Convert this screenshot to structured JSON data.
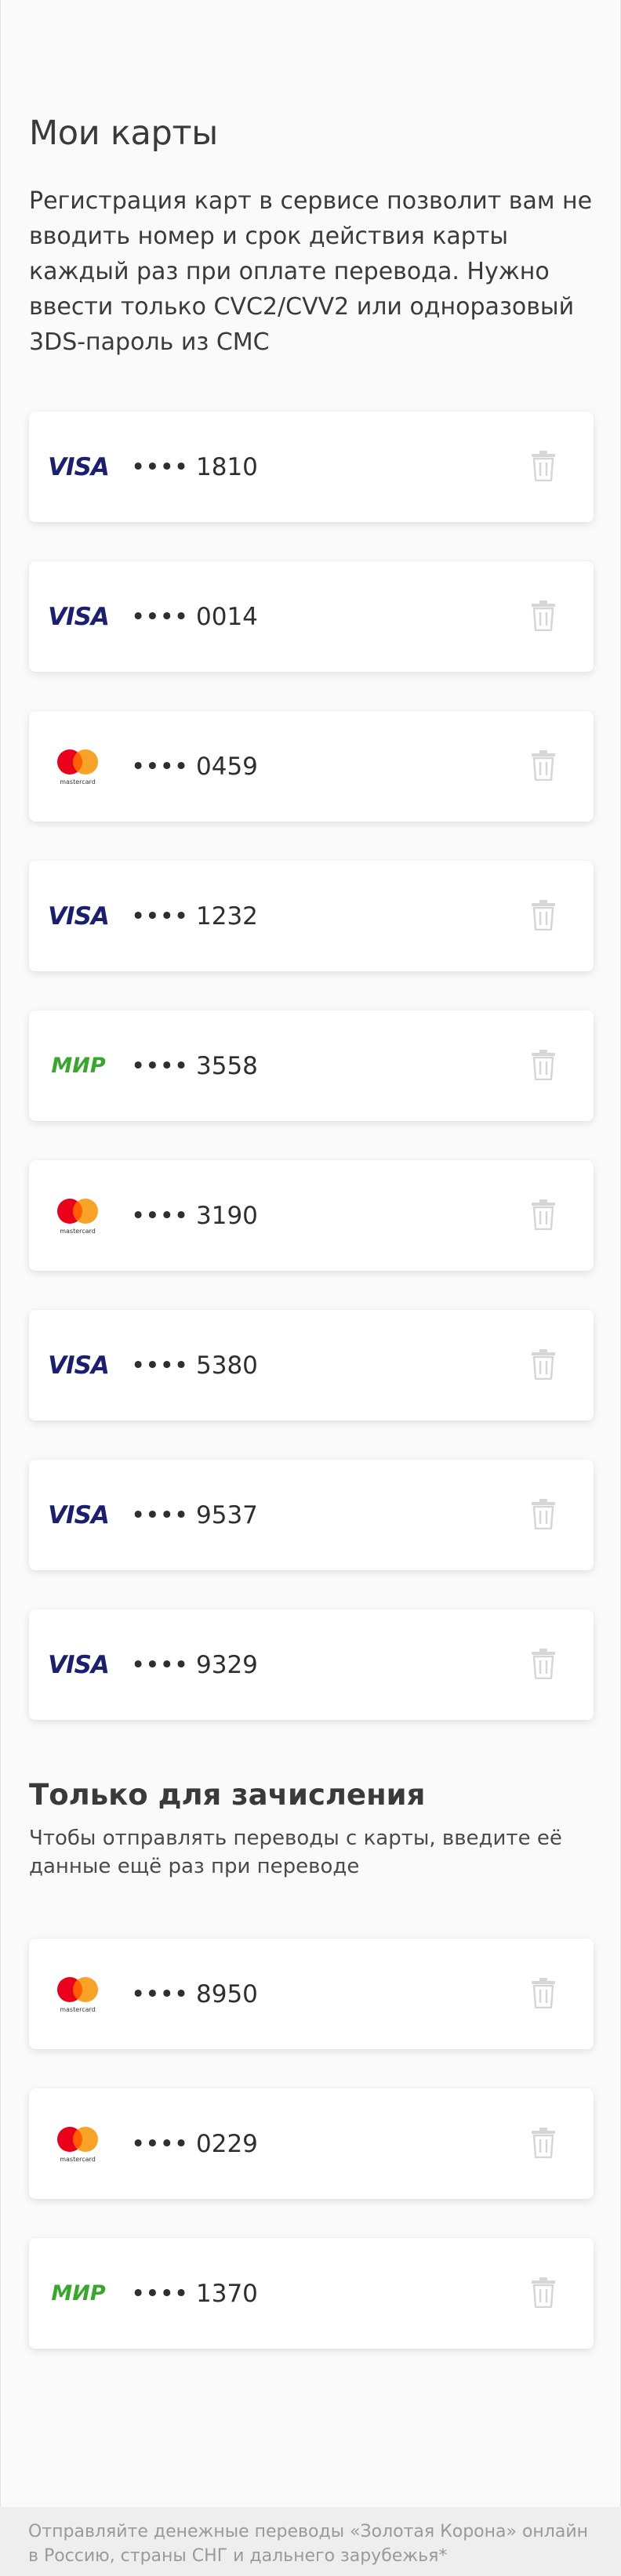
{
  "page": {
    "title": "Мои карты",
    "intro": "Регистрация карт в сервисе позволит вам не вводить номер и срок действия карты каждый раз при оплате перевода. Нужно ввести только CVC2/CVV2 или одноразовый 3DS-пароль из СМС"
  },
  "cards": [
    {
      "brand": "visa",
      "number": "•••• 1810"
    },
    {
      "brand": "visa",
      "number": "•••• 0014"
    },
    {
      "brand": "mastercard",
      "number": "•••• 0459"
    },
    {
      "brand": "visa",
      "number": "•••• 1232"
    },
    {
      "brand": "mir",
      "number": "•••• 3558"
    },
    {
      "brand": "mastercard",
      "number": "•••• 3190"
    },
    {
      "brand": "visa",
      "number": "•••• 5380"
    },
    {
      "brand": "visa",
      "number": "•••• 9537"
    },
    {
      "brand": "visa",
      "number": "•••• 9329"
    }
  ],
  "credit_only": {
    "title": "Только для зачисления",
    "description": "Чтобы отправлять переводы с карты, введите её данные ещё раз при переводе",
    "cards": [
      {
        "brand": "mastercard",
        "number": "•••• 8950"
      },
      {
        "brand": "mastercard",
        "number": "•••• 0229"
      },
      {
        "brand": "mir",
        "number": "•••• 1370"
      }
    ]
  },
  "brand_text": {
    "visa": "VISA",
    "mir": "МИР",
    "mastercard": "mastercard"
  },
  "footer": {
    "text": "Отправляйте денежные переводы «Золотая Корона» онлайн в Россию, страны СНГ и дальнего зарубежья*"
  },
  "icons": {
    "delete": "trash-icon"
  },
  "colors": {
    "visa": "#1a1f71",
    "mir": "#37a72e",
    "mc_red": "#eb001b",
    "mc_yellow": "#f79e1b",
    "trash": "#d6d6d6",
    "background": "#fafafa"
  }
}
